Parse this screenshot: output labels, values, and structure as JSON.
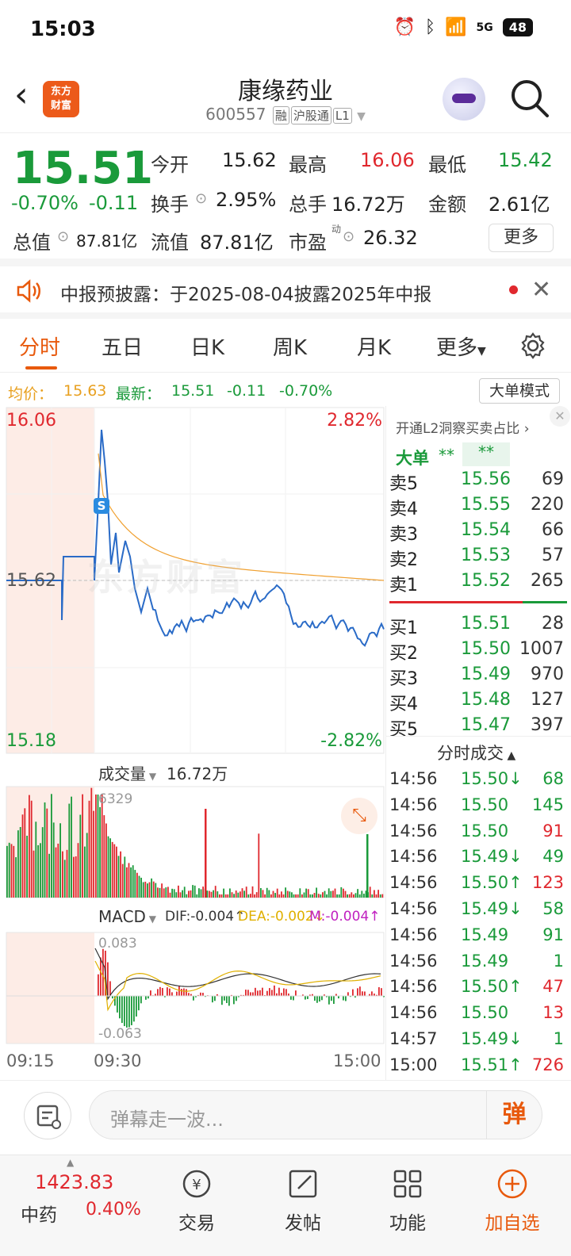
{
  "status": {
    "time": "15:03",
    "battery": "48",
    "network": "5G"
  },
  "header": {
    "title": "康缘药业",
    "code": "600557",
    "tags": [
      "融",
      "沪股通",
      "L1"
    ],
    "logo": "东方财富"
  },
  "quote": {
    "price": "15.51",
    "pct": "-0.70%",
    "chg": "-0.11",
    "open_label": "今开",
    "open": "15.62",
    "high_label": "最高",
    "high": "16.06",
    "low_label": "最低",
    "low": "15.42",
    "turnover_label": "换手",
    "turnover": "2.95%",
    "volume_label": "总手",
    "volume": "16.72万",
    "amount_label": "金额",
    "amount": "2.61亿",
    "mcap_label": "总值",
    "mcap": "87.81亿",
    "float_label": "流值",
    "float": "87.81亿",
    "pe_label": "市盈",
    "pe_sup": "动",
    "pe": "26.32",
    "more": "更多"
  },
  "notice": {
    "text": "中报预披露：于2025-08-04披露2025年中报"
  },
  "tabs": [
    "分时",
    "五日",
    "日K",
    "周K",
    "月K",
    "更多"
  ],
  "infoline": {
    "avg_label": "均价：",
    "avg": "15.63",
    "latest_label": "最新：",
    "latest": "15.51",
    "chg": "-0.11",
    "pct": "-0.70%",
    "big_mode": "大单模式"
  },
  "chart": {
    "top_price": "16.06",
    "top_pct": "2.82%",
    "mid_price": "15.62",
    "bottom_price": "15.18",
    "bottom_pct": "-2.82%",
    "vol_label": "成交量",
    "vol_total": "16.72万",
    "vol_max": "6329",
    "macd_label": "MACD",
    "dif": "DIF:-0.004↑",
    "dea": "DEA:-0.002↓",
    "m": "M:-0.004↑",
    "macd_top": "0.083",
    "macd_bottom": "-0.063",
    "time_labels": [
      "09:15",
      "09:30",
      "15:00"
    ],
    "watermark": "东方财富"
  },
  "orderbook": {
    "header": "开通L2洞察买卖占比",
    "bigorder_label": "大单",
    "bigorder_v1": "**",
    "bigorder_v2": "**",
    "sells": [
      {
        "label": "卖5",
        "price": "15.56",
        "vol": "69"
      },
      {
        "label": "卖4",
        "price": "15.55",
        "vol": "220"
      },
      {
        "label": "卖3",
        "price": "15.54",
        "vol": "66"
      },
      {
        "label": "卖2",
        "price": "15.53",
        "vol": "57"
      },
      {
        "label": "卖1",
        "price": "15.52",
        "vol": "265"
      }
    ],
    "buys": [
      {
        "label": "买1",
        "price": "15.51",
        "vol": "28"
      },
      {
        "label": "买2",
        "price": "15.50",
        "vol": "1007"
      },
      {
        "label": "买3",
        "price": "15.49",
        "vol": "970"
      },
      {
        "label": "买4",
        "price": "15.48",
        "vol": "127"
      },
      {
        "label": "买5",
        "price": "15.47",
        "vol": "397"
      }
    ],
    "trades_title": "分时成交",
    "trades": [
      {
        "t": "14:56",
        "p": "15.50↓",
        "v": "68",
        "pc": "green",
        "vc": "green"
      },
      {
        "t": "14:56",
        "p": "15.50",
        "v": "145",
        "pc": "green",
        "vc": "green"
      },
      {
        "t": "14:56",
        "p": "15.50",
        "v": "91",
        "pc": "green",
        "vc": "red"
      },
      {
        "t": "14:56",
        "p": "15.49↓",
        "v": "49",
        "pc": "green",
        "vc": "green"
      },
      {
        "t": "14:56",
        "p": "15.50↑",
        "v": "123",
        "pc": "green",
        "vc": "red"
      },
      {
        "t": "14:56",
        "p": "15.49↓",
        "v": "58",
        "pc": "green",
        "vc": "green"
      },
      {
        "t": "14:56",
        "p": "15.49",
        "v": "91",
        "pc": "green",
        "vc": "green"
      },
      {
        "t": "14:56",
        "p": "15.49",
        "v": "1",
        "pc": "green",
        "vc": "green"
      },
      {
        "t": "14:56",
        "p": "15.50↑",
        "v": "47",
        "pc": "green",
        "vc": "red"
      },
      {
        "t": "14:56",
        "p": "15.50",
        "v": "13",
        "pc": "green",
        "vc": "red"
      },
      {
        "t": "14:57",
        "p": "15.49↓",
        "v": "1",
        "pc": "green",
        "vc": "green"
      },
      {
        "t": "15:00",
        "p": "15.51↑",
        "v": "726",
        "pc": "green",
        "vc": "red"
      }
    ]
  },
  "danmu": {
    "placeholder": "弹幕走一波...",
    "button": "弹"
  },
  "bottomnav": {
    "index_value": "1423.83",
    "index_name": "中药",
    "index_pct": "0.40%",
    "items": [
      "交易",
      "发帖",
      "功能",
      "加自选"
    ]
  },
  "colors": {
    "up": "#e0282e",
    "down": "#1a9a3a",
    "accent": "#e8590c",
    "avg_line": "#f0a030",
    "price_line": "#2a6bc7"
  }
}
